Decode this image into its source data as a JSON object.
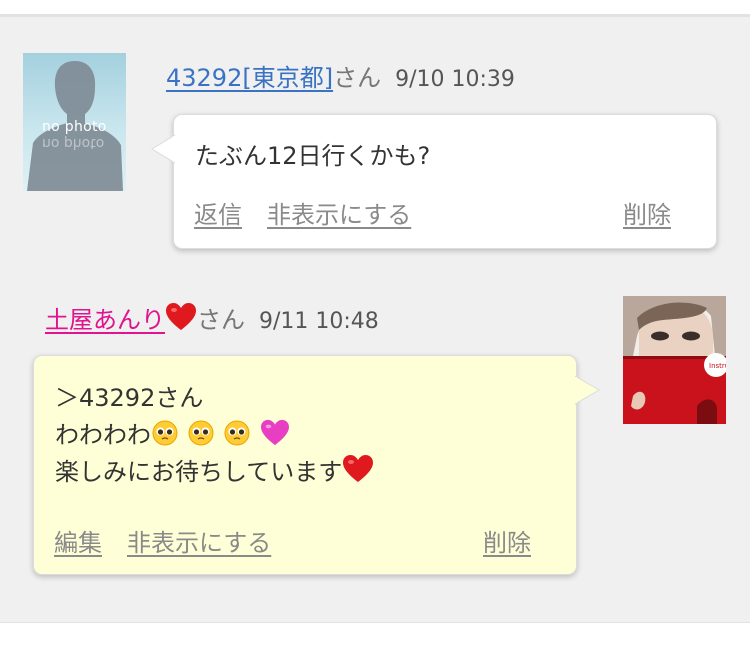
{
  "comments": [
    {
      "user": "43292[東京都]",
      "honorific": "さん",
      "time": "9/10 10:39",
      "avatar_text": "no photo",
      "message": "たぶん12日行くかも?",
      "actions": {
        "reply": "返信",
        "hide": "非表示にする",
        "delete": "削除"
      }
    },
    {
      "user": "土屋あんり",
      "honorific": "さん",
      "time": "9/11 10:48",
      "avatar_book_text": "Instruct",
      "message_lines": [
        "＞43292さん",
        "わわわわ",
        "楽しみにお待ちしています"
      ],
      "actions": {
        "edit": "編集",
        "hide": "非表示にする",
        "delete": "削除"
      }
    }
  ],
  "colors": {
    "background": "#f0f0f0",
    "link_blue": "#3a72c4",
    "link_pink": "#e0148e",
    "own_bubble": "#ffffd7",
    "other_bubble": "#ffffff"
  },
  "icons": [
    "red-heart-icon",
    "pleading-face-icon",
    "pink-heart-icon"
  ]
}
